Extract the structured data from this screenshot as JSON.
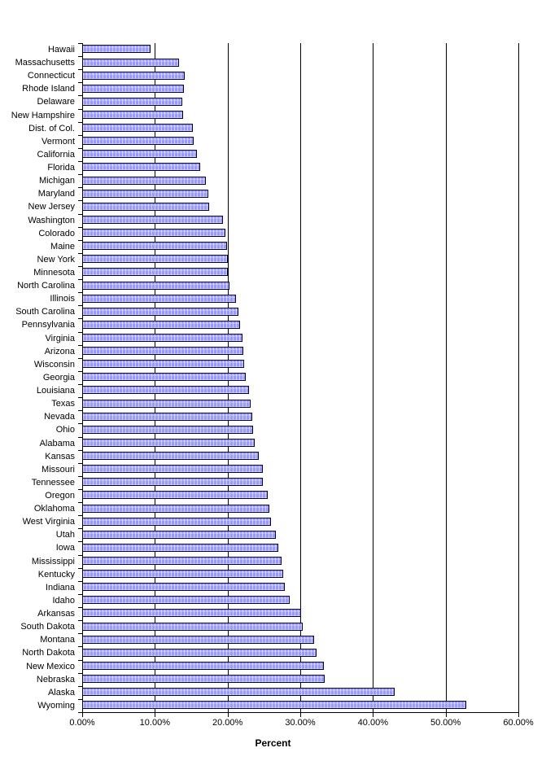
{
  "chart_data": {
    "type": "bar",
    "orientation": "horizontal",
    "title": "",
    "xlabel": "Percent",
    "ylabel": "",
    "xlim": [
      0,
      60
    ],
    "xtick_labels": [
      "0.00%",
      "10.00%",
      "20.00%",
      "30.00%",
      "40.00%",
      "50.00%",
      "60.00%"
    ],
    "xtick_values": [
      0,
      10,
      20,
      30,
      40,
      50,
      60
    ],
    "grid": "vertical",
    "legend": "none",
    "bar_color": "#9999ff",
    "bar_border_color": "#000033",
    "categories": [
      "Hawaii",
      "Massachusetts",
      "Connecticut",
      "Rhode Island",
      "Delaware",
      "New Hampshire",
      "Dist. of Col.",
      "Vermont",
      "California",
      "Florida",
      "Michigan",
      "Maryland",
      "New Jersey",
      "Washington",
      "Colorado",
      "Maine",
      "New York",
      "Minnesota",
      "North Carolina",
      "Illinois",
      "South Carolina",
      "Pennsylvania",
      "Virginia",
      "Arizona",
      "Wisconsin",
      "Georgia",
      "Louisiana",
      "Texas",
      "Nevada",
      "Ohio",
      "Alabama",
      "Kansas",
      "Missouri",
      "Tennessee",
      "Oregon",
      "Oklahoma",
      "West Virginia",
      "Utah",
      "Iowa",
      "Mississippi",
      "Kentucky",
      "Indiana",
      "Idaho",
      "Arkansas",
      "South Dakota",
      "Montana",
      "North Dakota",
      "New Mexico",
      "Nebraska",
      "Alaska",
      "Wyoming"
    ],
    "values": [
      9.4,
      13.3,
      14.1,
      14.0,
      13.8,
      13.9,
      15.2,
      15.3,
      15.8,
      16.2,
      17.0,
      17.3,
      17.5,
      19.4,
      19.7,
      19.9,
      20.0,
      20.0,
      20.3,
      21.2,
      21.5,
      21.7,
      22.0,
      22.2,
      22.3,
      22.5,
      22.9,
      23.2,
      23.4,
      23.5,
      23.7,
      24.3,
      24.8,
      24.9,
      25.5,
      25.8,
      26.0,
      26.6,
      27.0,
      27.4,
      27.6,
      27.9,
      28.6,
      30.1,
      30.3,
      31.9,
      32.2,
      33.2,
      33.4,
      43.0,
      52.8
    ]
  }
}
